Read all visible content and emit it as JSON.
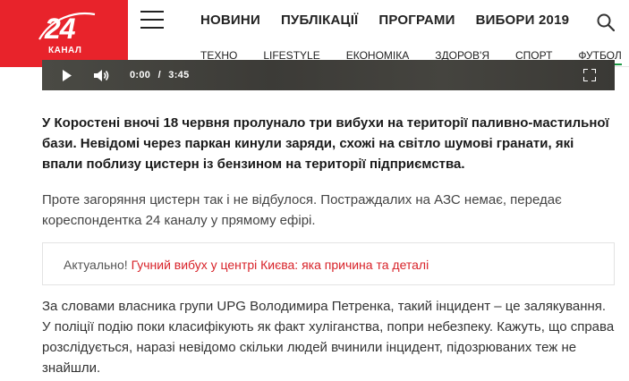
{
  "logo": {
    "number": "24",
    "name": "КАНАЛ"
  },
  "nav_main": [
    "НОВИНИ",
    "ПУБЛІКАЦІЇ",
    "ПРОГРАМИ",
    "ВИБОРИ 2019"
  ],
  "nav_sub": [
    {
      "label": "ТЕХНО"
    },
    {
      "label": "LIFESTYLE"
    },
    {
      "label": "ЕКОНОМІКА"
    },
    {
      "label": "ЗДОРОВ'Я"
    },
    {
      "label": "СПОРТ"
    },
    {
      "label": "ФУТБОЛ"
    }
  ],
  "video": {
    "current": "0:00",
    "separator": "/",
    "duration": "3:45"
  },
  "article": {
    "lead": "У Коростені вночі 18 червня пролунало три вибухи на території паливно-мастильної бази. Невідомі через паркан кинули заряди, схожі на світло шумові гранати, які впали поблизу цистерн із бензином на території підприємства.",
    "p1": "Проте загоряння цистерн так і не відбулося. Постраждалих на АЗС немає, передає кореспондентка 24 каналу у прямому ефірі.",
    "related": {
      "label": "Актуально!",
      "link": "Гучний вибух у центрі Києва: яка причина та деталі"
    },
    "p2": "За словами власника групи UPG Володимира Петренка, такий інцидент – це залякування. У поліції подію поки класифікують як факт хуліганства, попри небезпеку. Кажуть, що справа розслідується, наразі невідомо скільки людей вчинили інцидент, підозрюваних теж не знайшли."
  },
  "colors": {
    "brand_red": "#e8232b",
    "sub_nav_accent": "#1d9a45",
    "link_red": "#d8232a"
  },
  "icons": [
    "menu-icon",
    "search-icon",
    "play-icon",
    "volume-icon",
    "fullscreen-icon"
  ]
}
